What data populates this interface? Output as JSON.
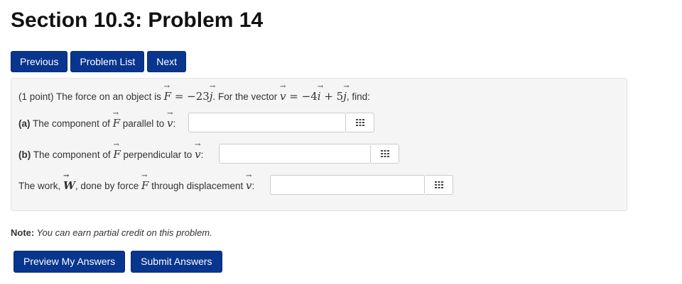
{
  "page_title": "Section 10.3: Problem 14",
  "nav": {
    "previous_label": "Previous",
    "problem_list_label": "Problem List",
    "next_label": "Next"
  },
  "problem": {
    "points_text": "(1 point) The force on an object is ",
    "F_symbol": "F",
    "F_value": "= −23",
    "j_symbol": "j",
    "vector_text": ". For the vector ",
    "v_symbol": "v",
    "v_value_a": "= −4",
    "i_symbol": "i",
    "v_value_b": "+ 5",
    "find_text": ", find:",
    "part_a": {
      "label": "(a)",
      "text_1": " The component of ",
      "text_2": " parallel to ",
      "text_3": ":",
      "value": ""
    },
    "part_b": {
      "label": "(b)",
      "text_1": " The component of ",
      "text_2": " perpendicular to ",
      "text_3": ":",
      "value": ""
    },
    "part_c": {
      "text_1": "The work, ",
      "W_symbol": "W",
      "text_2": ", done by force ",
      "text_3": " through displacement ",
      "text_4": ":",
      "value": ""
    }
  },
  "note": {
    "label": "Note:",
    "text": " You can earn partial credit on this problem."
  },
  "actions": {
    "preview_label": "Preview My Answers",
    "submit_label": "Submit Answers"
  },
  "icons": {
    "palette": "equation-palette-icon"
  },
  "colors": {
    "button_bg": "#08358e",
    "panel_bg": "#f5f5f5"
  }
}
